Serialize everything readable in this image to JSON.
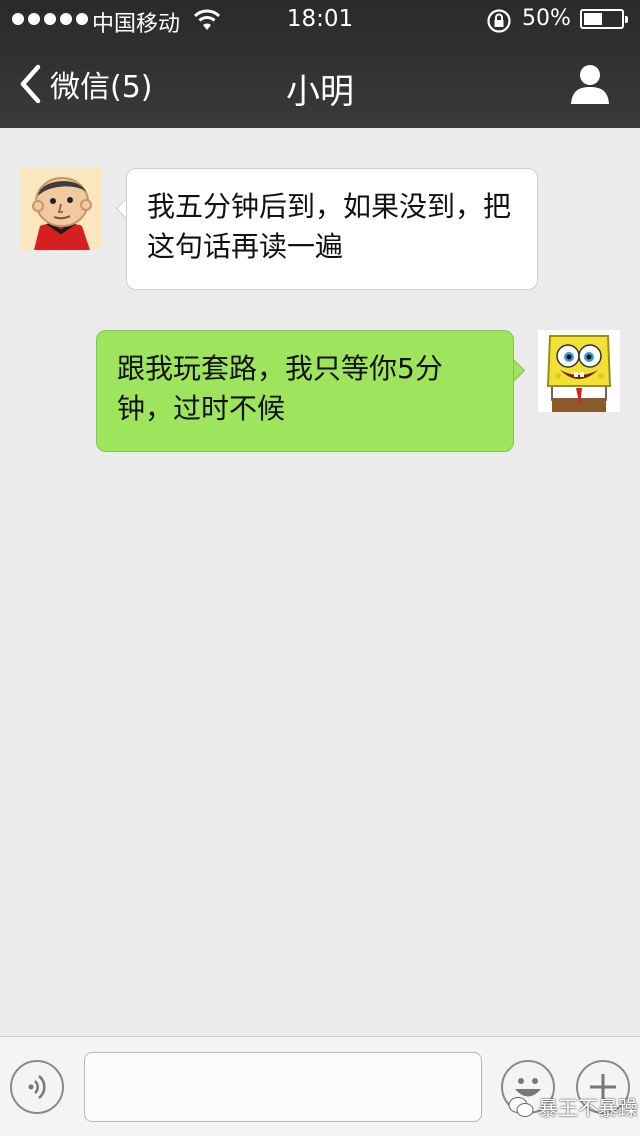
{
  "status_bar": {
    "carrier": "中国移动",
    "time": "18:01",
    "battery_percent": "50%",
    "battery_level": 0.5
  },
  "nav": {
    "back_label": "微信(5)",
    "title": "小明"
  },
  "messages": [
    {
      "direction": "incoming",
      "sender_avatar": "cartoon-boy-avatar",
      "text_line1": "我五分钟后到，如果没到，把",
      "text_line2": "这句话再读一遍"
    },
    {
      "direction": "outgoing",
      "sender_avatar": "spongebob-avatar",
      "text_line1": "跟我玩套路，我只等你5分",
      "text_line2": "钟，过时不候"
    }
  ],
  "input": {
    "placeholder": ""
  },
  "watermark": "暴王不暴躁",
  "colors": {
    "topbar": "#2f2f31",
    "chat_bg": "#ebebeb",
    "outgoing_bubble": "#9ee55d",
    "incoming_bubble": "#ffffff"
  }
}
